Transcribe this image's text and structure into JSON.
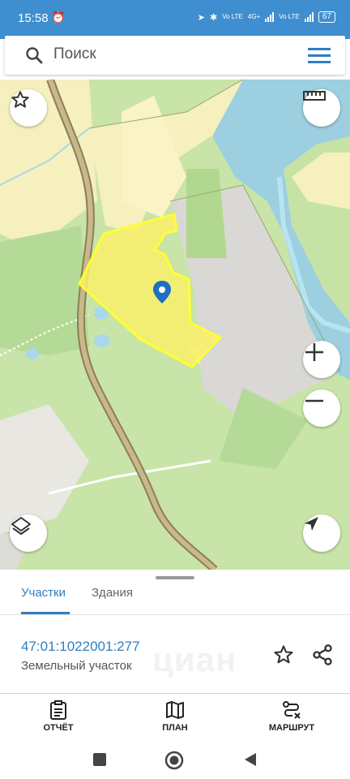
{
  "status_bar": {
    "time": "15:58",
    "network_4g": "4G+",
    "volte1": "Vo LTE",
    "volte2": "Vo LTE",
    "battery": "67"
  },
  "search": {
    "placeholder": "Поиск",
    "search_icon": "search-icon",
    "menu_icon": "hamburger-menu-icon"
  },
  "map": {
    "accent": "#ffff33",
    "water_color": "#9ccfe0",
    "forest_color": "#c6e3a5",
    "field_color": "#f6f0bf",
    "controls": [
      "favorite-icon",
      "ruler-icon",
      "zoom-in-icon",
      "zoom-out-icon",
      "layers-icon",
      "locate-icon"
    ]
  },
  "panel": {
    "tabs": [
      {
        "label": "Участки",
        "active": true
      },
      {
        "label": "Здания",
        "active": false
      }
    ],
    "parcel": {
      "cadastral_number": "47:01:1022001:277",
      "type": "Земельный участок"
    },
    "watermark": "циан",
    "accent": "#2f7fbf"
  },
  "bottom_nav": [
    {
      "label": "ОТЧЁТ",
      "icon": "report-icon"
    },
    {
      "label": "ПЛАН",
      "icon": "map-plan-icon"
    },
    {
      "label": "МАРШРУТ",
      "icon": "route-icon"
    }
  ]
}
